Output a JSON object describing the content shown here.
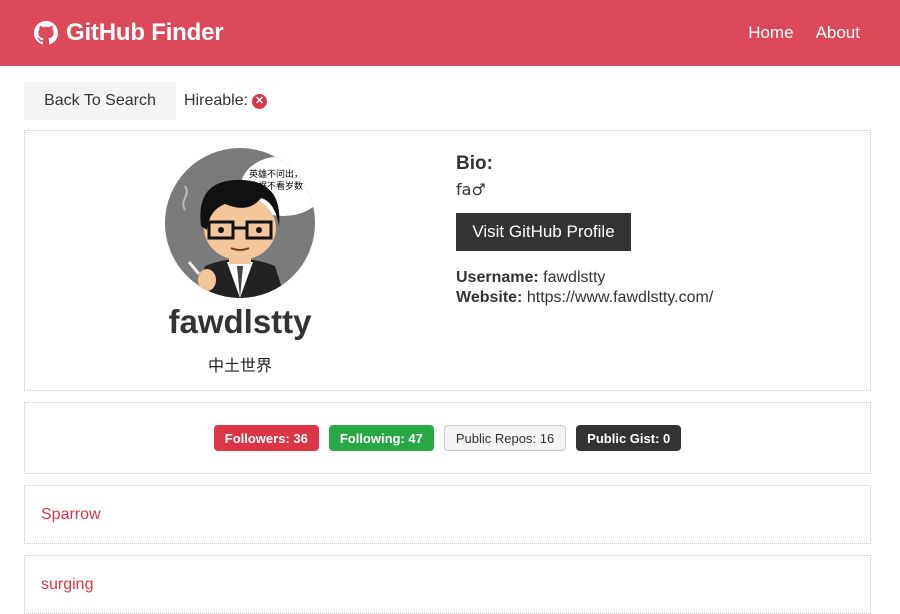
{
  "navbar": {
    "brand": "GitHub Finder",
    "links": [
      "Home",
      "About"
    ]
  },
  "actions": {
    "back_label": "Back To Search",
    "hireable_label": "Hireable:",
    "hireable_value": "no"
  },
  "profile": {
    "name": "fawdlstty",
    "location": "中土世界",
    "avatar_text_line1": "英雄不问出，",
    "avatar_text_line2": "流氓不看岁数",
    "bio_label": "Bio:",
    "bio": "fa♂",
    "visit_label": "Visit GitHub Profile",
    "username_label": "Username:",
    "username": "fawdlstty",
    "website_label": "Website:",
    "website": "https://www.fawdlstty.com/"
  },
  "stats": {
    "followers": "Followers: 36",
    "following": "Following: 47",
    "public_repos": "Public Repos: 16",
    "public_gists": "Public Gist: 0"
  },
  "repos": [
    "Sparrow",
    "surging"
  ],
  "colors": {
    "navbar": "#dc4a59",
    "danger": "#dc3545",
    "success": "#28a745",
    "dark": "#333333",
    "light": "#f4f4f4"
  }
}
